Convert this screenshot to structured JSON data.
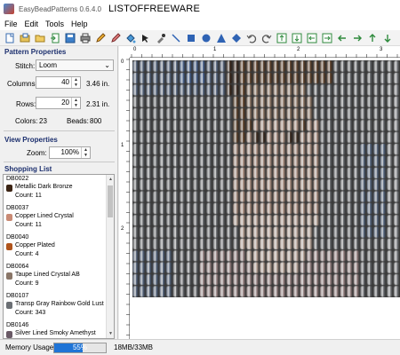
{
  "window": {
    "app_title": "EasyBeadPatterns 0.6.4.0",
    "watermark": "LISTOFFREEWARE"
  },
  "menu": [
    "File",
    "Edit",
    "Tools",
    "Help"
  ],
  "toolbar_icons": [
    "new-icon",
    "open-icon",
    "open-folder-icon",
    "import-icon",
    "save-icon",
    "print-icon",
    "pencil-icon",
    "erase-icon",
    "fill-icon",
    "select-arrow-icon",
    "dropper-icon",
    "line-icon",
    "rectangle-icon",
    "circle-icon",
    "triangle-icon",
    "diamond-icon",
    "undo-icon",
    "redo-icon",
    "flip-vertical-icon",
    "rotate-left-icon",
    "rotate-right-icon",
    "flip-horizontal-icon",
    "move-left-icon",
    "move-right-icon",
    "move-up-icon",
    "move-down-icon"
  ],
  "pattern_properties": {
    "title": "Pattern Properties",
    "stitch_label": "Stitch:",
    "stitch_value": "Loom",
    "columns_label": "Columns:",
    "columns_value": "40",
    "columns_inches": "3.46 in.",
    "rows_label": "Rows:",
    "rows_value": "20",
    "rows_inches": "2.31 in.",
    "colors_label": "Colors:",
    "colors_value": "23",
    "beads_label": "Beads:",
    "beads_value": "800"
  },
  "view_properties": {
    "title": "View Properties",
    "zoom_label": "Zoom:",
    "zoom_value": "100%"
  },
  "shopping_list": {
    "title": "Shopping List",
    "items": [
      {
        "code": "DB0022",
        "name": "Metallic Dark Bronze",
        "count": "Count: 11",
        "color": "#3b2414"
      },
      {
        "code": "DB0037",
        "name": "Copper Lined Crystal",
        "count": "Count: 11",
        "color": "#c98a74"
      },
      {
        "code": "DB0040",
        "name": "Copper Plated",
        "count": "Count: 4",
        "color": "#b0541c"
      },
      {
        "code": "DB0064",
        "name": "Taupe Lined Crystal AB",
        "count": "Count: 9",
        "color": "#8a7668"
      },
      {
        "code": "DB0107",
        "name": "Transp Gray Rainbow Gold Lust",
        "count": "Count: 343",
        "color": "#6b6f74"
      },
      {
        "code": "DB0146",
        "name": "Silver Lined Smoky Amethyst",
        "count": "",
        "color": "#6a5a66"
      }
    ]
  },
  "ruler": {
    "top": [
      "0",
      "1",
      "2",
      "3"
    ],
    "left": [
      "0",
      "1",
      "2"
    ]
  },
  "status": {
    "memory_label": "Memory Usage:",
    "memory_percent": "55%",
    "memory_fraction": 0.55,
    "memory_values": "18MB/33MB"
  },
  "palette": {
    "dark": "#2e2e30",
    "gray": "#6e7176",
    "light_gray": "#8c8f94",
    "blue_gray": "#5b6f8f",
    "blue": "#4c6ea8",
    "brown_dark": "#3b2414",
    "brown": "#6a4426",
    "tan": "#a98a72",
    "skin": "#c9a592",
    "light_skin": "#dcc1b1",
    "pink_gray": "#b59a9a"
  }
}
